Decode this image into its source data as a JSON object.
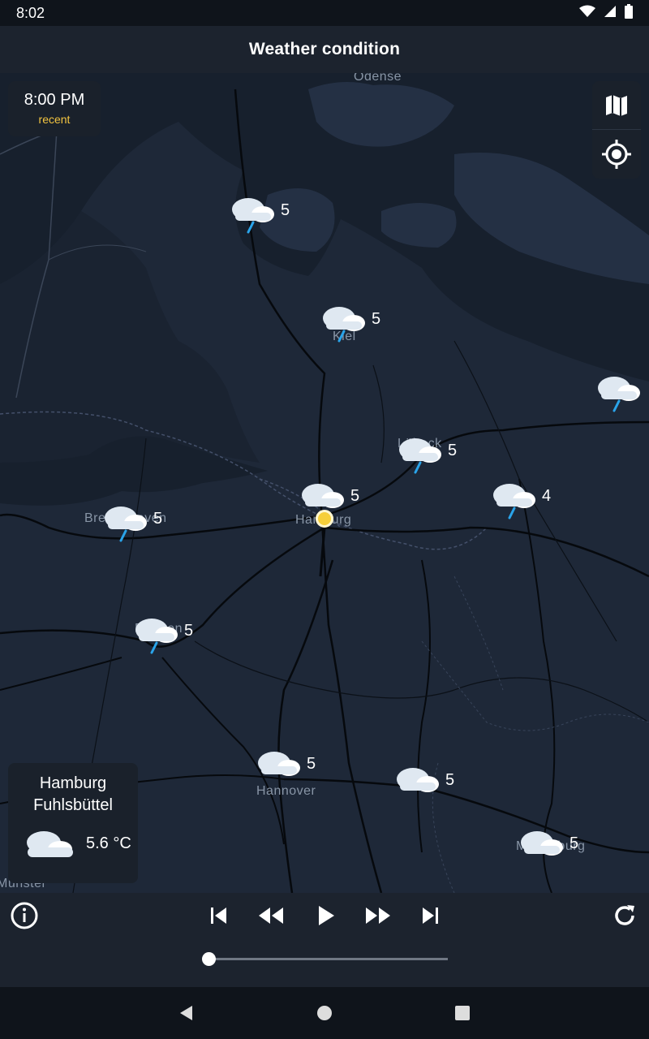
{
  "status_bar": {
    "time": "8:02"
  },
  "app_bar": {
    "title": "Weather condition"
  },
  "time_badge": {
    "time": "8:00 PM",
    "label": "recent"
  },
  "map": {
    "labels": [
      "Odense",
      "Kiel",
      "Lübeck",
      "Hamburg",
      "Bremerhaven",
      "Bremen",
      "Hannover",
      "Magdeburg",
      "Münster"
    ],
    "markers": [
      {
        "value": "5"
      },
      {
        "value": "5"
      },
      {
        "value": "5"
      },
      {
        "value": "5"
      },
      {
        "value": "4"
      },
      {
        "value": "5"
      },
      {
        "value": "5"
      },
      {
        "value": "5"
      },
      {
        "value": "5"
      },
      {
        "value": "5"
      }
    ]
  },
  "station": {
    "name": "Hamburg Fuhlsbüttel",
    "temperature": "5.6 °C"
  },
  "player": {
    "progress": 0.0
  }
}
